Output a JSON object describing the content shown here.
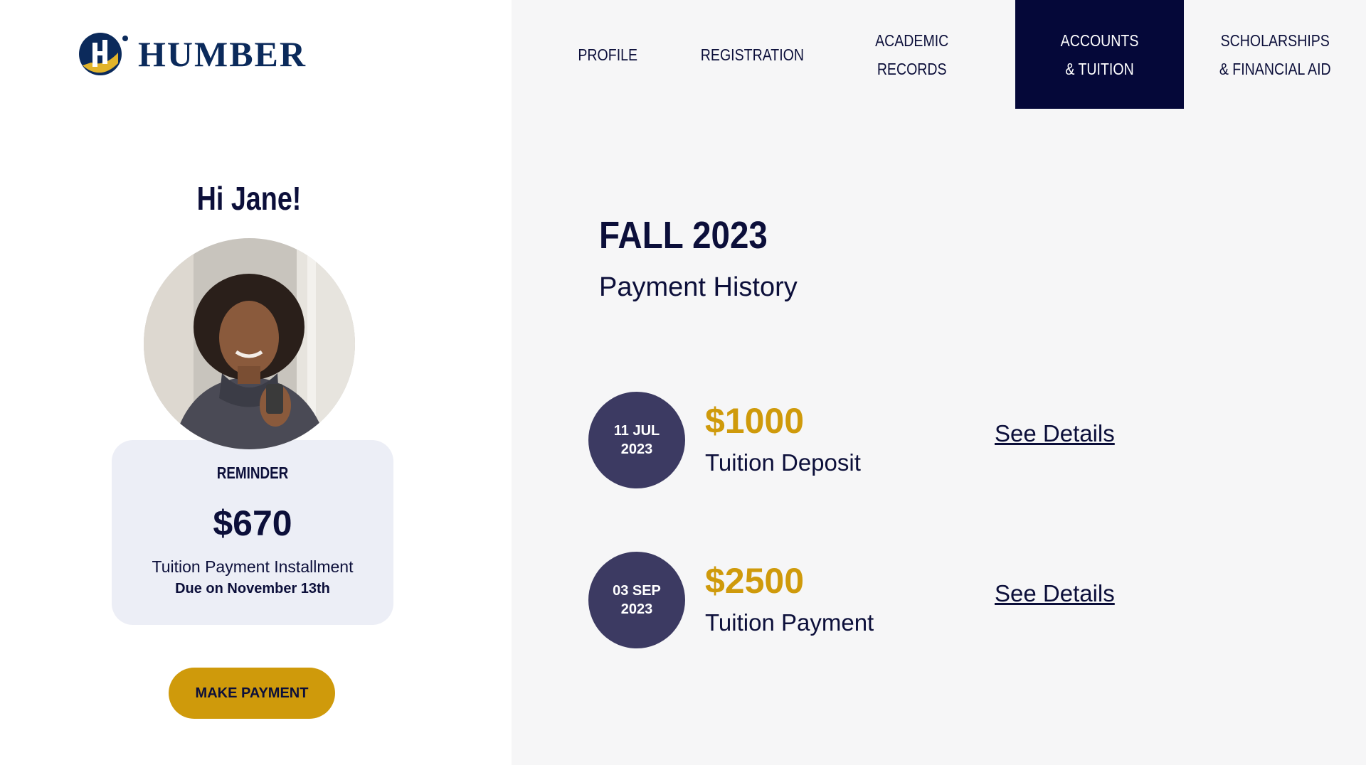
{
  "brand": {
    "name": "HUMBER"
  },
  "nav": {
    "items": [
      {
        "label": "PROFILE"
      },
      {
        "label": "REGISTRATION"
      },
      {
        "label": "ACADEMIC\nRECORDS"
      },
      {
        "label": "ACCOUNTS\n& TUITION",
        "active": true
      },
      {
        "label": "SCHOLARSHIPS\n& FINANCIAL AID"
      }
    ]
  },
  "user": {
    "greeting": "Hi Jane!"
  },
  "reminder": {
    "label": "REMINDER",
    "amount": "$670",
    "description": "Tuition Payment Installment",
    "due": "Due on November 13th"
  },
  "actions": {
    "make_payment_label": "MAKE PAYMENT"
  },
  "payments": {
    "season": "FALL 2023",
    "subtitle": "Payment History",
    "items": [
      {
        "date_day_month": "11 JUL",
        "date_year": "2023",
        "amount": "$1000",
        "description": "Tuition Deposit",
        "link": "See Details"
      },
      {
        "date_day_month": "03 SEP",
        "date_year": "2023",
        "amount": "$2500",
        "description": "Tuition Payment",
        "link": "See Details"
      }
    ]
  },
  "colors": {
    "navy": "#0c0f3a",
    "nav_active_bg": "#050839",
    "gold": "#cf9a0b",
    "date_circle": "#3c3a62",
    "card_bg": "#eceef6",
    "panel_bg": "#f6f6f7",
    "logo_blue": "#0b2a5b"
  }
}
